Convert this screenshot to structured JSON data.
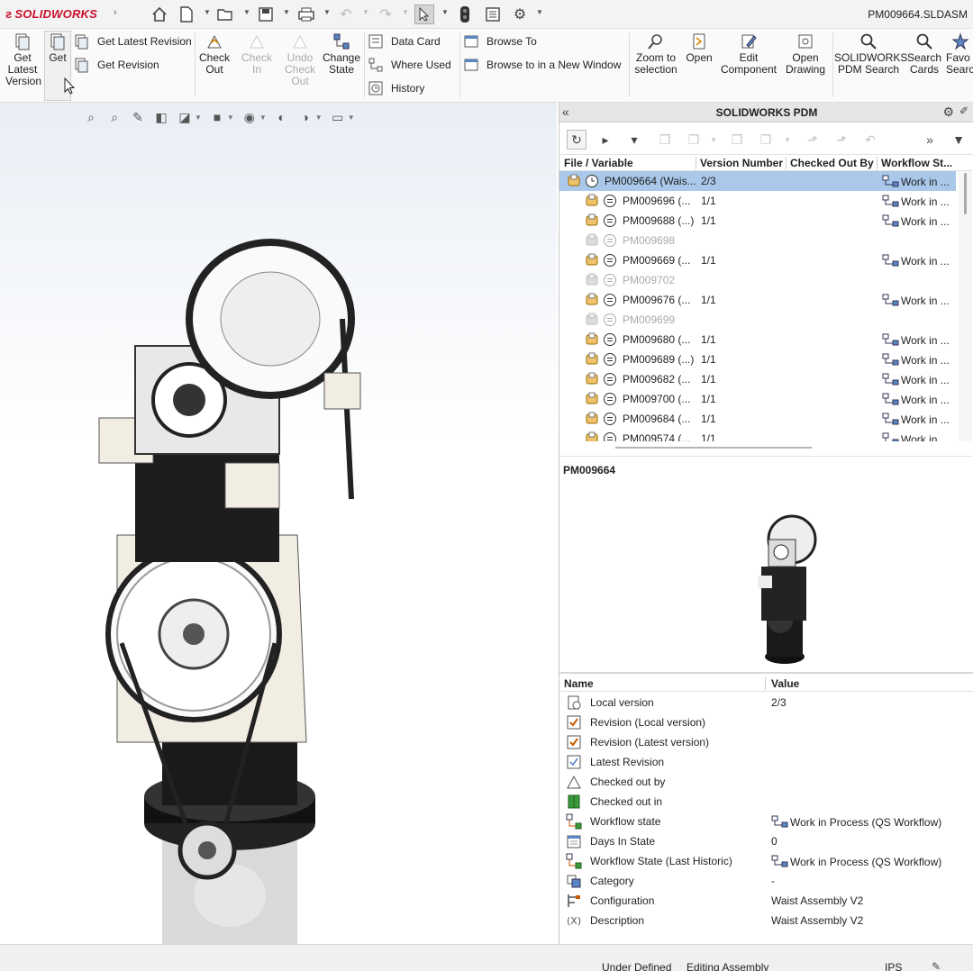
{
  "app": {
    "logo": "SOLIDWORKS",
    "document_title": "PM009664.SLDASM"
  },
  "ribbon": {
    "get_latest_version": "Get Latest Version",
    "get": "Get",
    "get_latest_revision": "Get Latest Revision",
    "get_revision": "Get Revision",
    "check_out": "Check Out",
    "check_in": "Check In",
    "undo_check_out": "Undo Check Out",
    "change_state": "Change State",
    "data_card": "Data Card",
    "where_used": "Where Used",
    "history": "History",
    "browse_to": "Browse To",
    "browse_to_new_window": "Browse to in a New Window",
    "zoom_to_selection": "Zoom to selection",
    "open": "Open",
    "edit_component": "Edit Component",
    "open_drawing": "Open Drawing",
    "pdm_search": "SOLIDWORKS PDM Search",
    "search_cards": "Search Cards",
    "favorite_searches": "Favo Searc"
  },
  "pdm": {
    "title": "SOLIDWORKS PDM",
    "columns": {
      "file": "File / Variable",
      "version": "Version Number",
      "checked_out_by": "Checked Out By",
      "workflow": "Workflow St..."
    },
    "files": [
      {
        "name": "PM009664  (Wais...",
        "version": "2/3",
        "workflow": "Work in ...",
        "selected": true,
        "root": true,
        "dim": false
      },
      {
        "name": "PM009696  (...",
        "version": "1/1",
        "workflow": "Work in ...",
        "dim": false
      },
      {
        "name": "PM009688  (...)",
        "version": "1/1",
        "workflow": "Work in ...",
        "dim": false
      },
      {
        "name": "PM009698",
        "version": "",
        "workflow": "",
        "dim": true
      },
      {
        "name": "PM009669  (...",
        "version": "1/1",
        "workflow": "Work in ...",
        "dim": false
      },
      {
        "name": "PM009702",
        "version": "",
        "workflow": "",
        "dim": true
      },
      {
        "name": "PM009676  (...",
        "version": "1/1",
        "workflow": "Work in ...",
        "dim": false
      },
      {
        "name": "PM009699",
        "version": "",
        "workflow": "",
        "dim": true
      },
      {
        "name": "PM009680  (...",
        "version": "1/1",
        "workflow": "Work in ...",
        "dim": false
      },
      {
        "name": "PM009689  (...)",
        "version": "1/1",
        "workflow": "Work in ...",
        "dim": false
      },
      {
        "name": "PM009682  (...",
        "version": "1/1",
        "workflow": "Work in ...",
        "dim": false
      },
      {
        "name": "PM009700  (...",
        "version": "1/1",
        "workflow": "Work in ...",
        "dim": false
      },
      {
        "name": "PM009684  (...",
        "version": "1/1",
        "workflow": "Work in ...",
        "dim": false
      },
      {
        "name": "PM009574  (...",
        "version": "1/1",
        "workflow": "Work in ...",
        "dim": false
      }
    ],
    "preview_title": "PM009664",
    "props_columns": {
      "name": "Name",
      "value": "Value"
    },
    "properties": [
      {
        "name": "Local version",
        "value": "2/3",
        "icon": "local-version-icon"
      },
      {
        "name": "Revision (Local version)",
        "value": "",
        "icon": "revision-check-icon"
      },
      {
        "name": "Revision (Latest version)",
        "value": "",
        "icon": "revision-check-icon"
      },
      {
        "name": "Latest Revision",
        "value": "",
        "icon": "latest-revision-icon"
      },
      {
        "name": "Checked out by",
        "value": "",
        "icon": "checked-out-by-icon"
      },
      {
        "name": "Checked out in",
        "value": "",
        "icon": "checked-out-in-icon"
      },
      {
        "name": "Workflow state",
        "value": "Work in Process (QS Workflow)",
        "icon": "workflow-icon"
      },
      {
        "name": "Days In State",
        "value": "0",
        "icon": "calendar-icon"
      },
      {
        "name": "Workflow State (Last Historic)",
        "value": "Work in Process (QS Workflow)",
        "icon": "workflow-icon"
      },
      {
        "name": "Category",
        "value": "-",
        "icon": "category-icon"
      },
      {
        "name": "Configuration",
        "value": "Waist Assembly V2",
        "icon": "configuration-icon"
      },
      {
        "name": "Description",
        "value": "Waist Assembly V2",
        "icon": "variable-icon"
      }
    ]
  },
  "status": {
    "under_defined": "Under Defined",
    "editing": "Editing Assembly",
    "units": "IPS"
  },
  "colors": {
    "accent": "#c8102e",
    "selection": "#aac8ea"
  }
}
